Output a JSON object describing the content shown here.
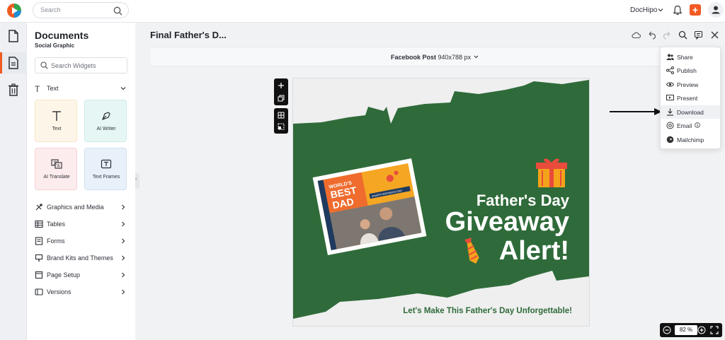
{
  "app": {
    "brand": "DocHipo",
    "search_placeholder": "Search"
  },
  "panel": {
    "title": "Documents",
    "subtitle": "Social Graphic",
    "widget_search_placeholder": "Search Widgets",
    "text_section": "Text",
    "tiles": [
      "Text",
      "AI Writer",
      "AI Translate",
      "Text Frames"
    ],
    "menu": [
      "Graphics and Media",
      "Tables",
      "Forms",
      "Brand Kits and Themes",
      "Page Setup",
      "Versions"
    ]
  },
  "editor": {
    "doc_title": "Final Father's D...",
    "size_name": "Facebook Post",
    "size_dims": "940x788 px",
    "zoom": "82 %"
  },
  "dropdown": [
    "Share",
    "Publish",
    "Preview",
    "Present",
    "Download",
    "Email",
    "Mailchimp"
  ],
  "design": {
    "heading": "Father's Day",
    "big1": "Giveaway",
    "big2": "Alert!",
    "tagline": "Let's Make This Father's Day Unforgettable!",
    "photo_badge1": "WORLD'S",
    "photo_badge2": "BEST",
    "photo_badge3": "DAD",
    "hashtag": "#HAPPYFATHER'S DAY"
  },
  "colors": {
    "accent": "#f15a22",
    "canvas_green": "#2f6b3a",
    "tagline_green": "#2f6b3a"
  }
}
